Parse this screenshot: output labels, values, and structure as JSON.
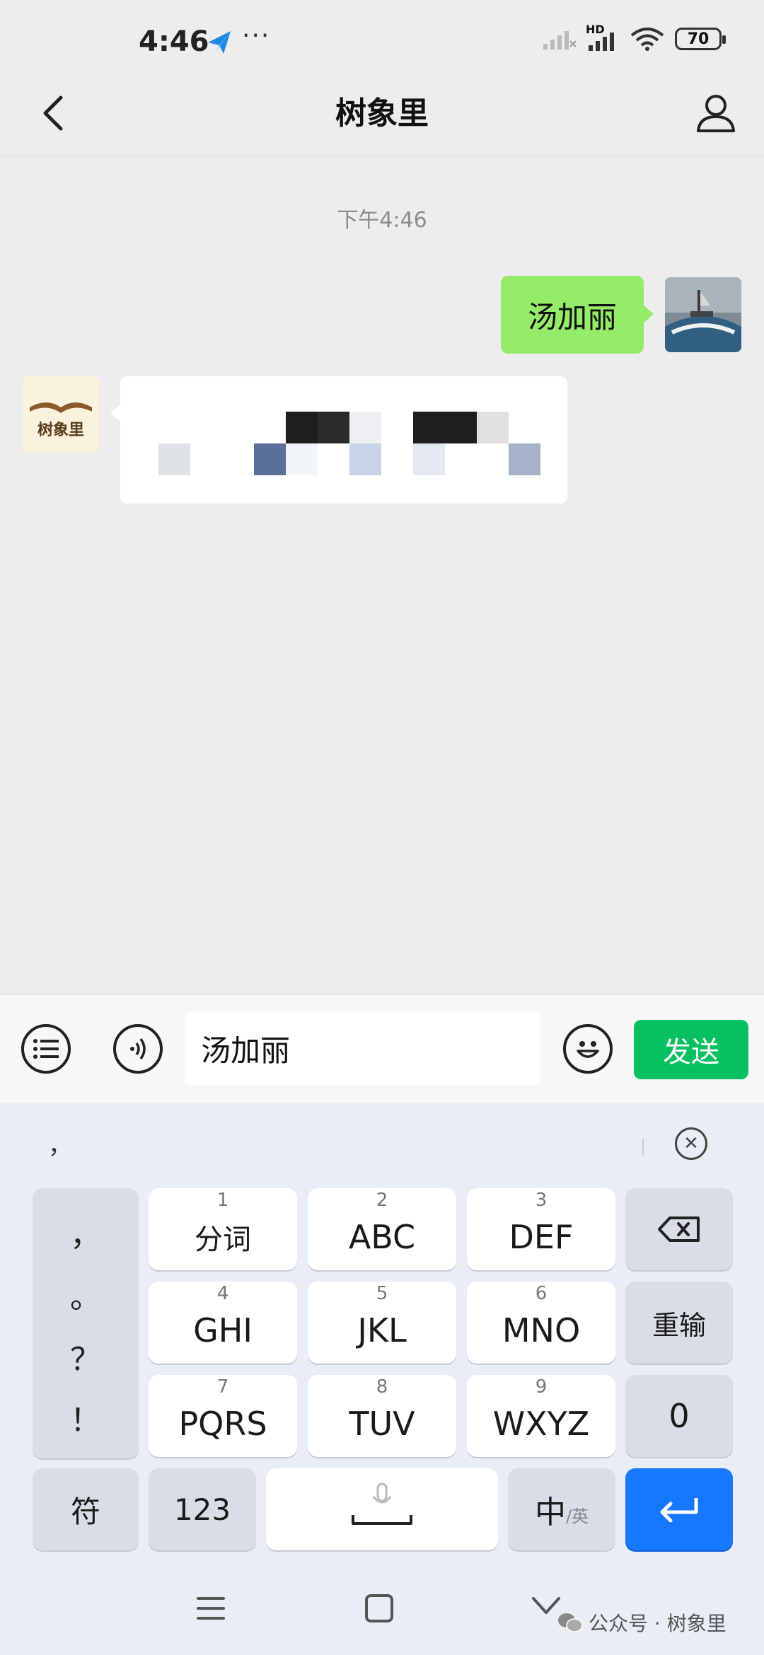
{
  "status_bar": {
    "time": "4:46",
    "more": "···",
    "network": "HD",
    "battery": "70"
  },
  "header": {
    "title": "树象里"
  },
  "chat": {
    "timestamp": "下午4:46",
    "outgoing_message": "汤加丽",
    "bot_avatar_text": "树象里"
  },
  "input_bar": {
    "text_value": "汤加丽",
    "send_label": "发送"
  },
  "keyboard": {
    "candidate": "，",
    "punctuation": [
      "，",
      "。",
      "？",
      "！"
    ],
    "keys": [
      {
        "num": "1",
        "label": "分词"
      },
      {
        "num": "2",
        "label": "ABC"
      },
      {
        "num": "3",
        "label": "DEF"
      },
      {
        "num": "4",
        "label": "GHI"
      },
      {
        "num": "5",
        "label": "JKL"
      },
      {
        "num": "6",
        "label": "MNO"
      },
      {
        "num": "7",
        "label": "PQRS"
      },
      {
        "num": "8",
        "label": "TUV"
      },
      {
        "num": "9",
        "label": "WXYZ"
      }
    ],
    "retype_label": "重输",
    "zero_label": "0",
    "symbol_label": "符",
    "numbers_label": "123",
    "lang_main": "中",
    "lang_alt": "/英"
  },
  "watermark": {
    "text": "公众号 · 树象里"
  },
  "colors": {
    "wechat_green": "#07c160",
    "bubble_green": "#95ec69",
    "enter_blue": "#1677ff"
  }
}
